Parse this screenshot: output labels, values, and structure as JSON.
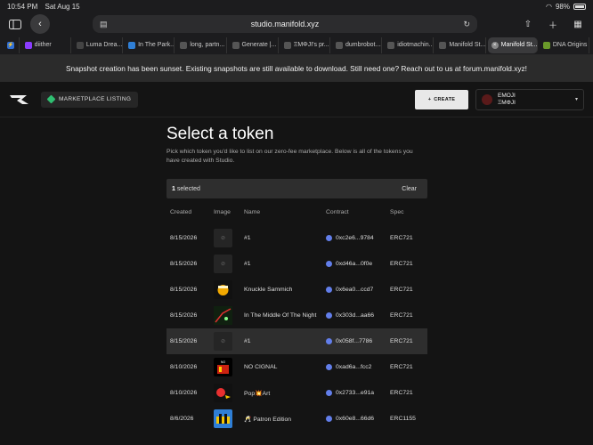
{
  "status": {
    "time": "10:54 PM",
    "date": "Sat Aug 15",
    "battery": "98%"
  },
  "browser": {
    "url": "studio.manifold.xyz",
    "tabs": [
      {
        "label": "diither",
        "color": "#8a3cff"
      },
      {
        "label": "Luma Drea...",
        "color": "#444"
      },
      {
        "label": "In The Park...",
        "color": "#2f7fd6"
      },
      {
        "label": "long, partn...",
        "color": "#555"
      },
      {
        "label": "Generate |...",
        "color": "#555"
      },
      {
        "label": "ΞMΦJI's pr...",
        "color": "#555"
      },
      {
        "label": "dumbrobot....",
        "color": "#555"
      },
      {
        "label": "idiotmachin...",
        "color": "#555"
      },
      {
        "label": "Manifold St...",
        "color": "#555"
      },
      {
        "label": "Manifold St...",
        "color": "#888",
        "active": true
      },
      {
        "label": "DNA Origins",
        "color": "#6a9a2a"
      }
    ]
  },
  "banner": {
    "text": "Snapshot creation has been sunset. Existing snapshots are still available to download. Still need one? Reach out to us at forum.manifold.xyz!"
  },
  "header": {
    "marketplace_label": "MARKETPLACE LISTING",
    "create_label": "CREATE",
    "account_line1": "EMOJI",
    "account_line2": "ΞMΦJI"
  },
  "main": {
    "title": "Select a token",
    "subtitle": "Pick which token you'd like to list on our zero-fee marketplace. Below is all of the tokens you have created with Studio.",
    "selected_count": "1",
    "selected_label": "selected",
    "clear_label": "Clear",
    "columns": [
      "Created",
      "Image",
      "Name",
      "Contract",
      "Spec"
    ],
    "rows": [
      {
        "created": "8/15/2026",
        "image": "empty",
        "name": "#1",
        "contract": "0xc2e6...9784",
        "spec": "ERC721"
      },
      {
        "created": "8/15/2026",
        "image": "empty",
        "name": "#1",
        "contract": "0xd46a...0f0e",
        "spec": "ERC721"
      },
      {
        "created": "8/15/2026",
        "image": "knuckle",
        "name": "Knuckle Sammich",
        "contract": "0x6ea0...ccd7",
        "spec": "ERC721"
      },
      {
        "created": "8/15/2026",
        "image": "middle",
        "name": "In The Middle Of The Night",
        "contract": "0x303d...aa66",
        "spec": "ERC721"
      },
      {
        "created": "8/15/2026",
        "image": "empty",
        "name": "#1",
        "contract": "0x058f...7786",
        "spec": "ERC721",
        "selected": true
      },
      {
        "created": "8/10/2026",
        "image": "cignal",
        "name": "NO CIGNAL",
        "contract": "0xad6a...fcc2",
        "spec": "ERC721"
      },
      {
        "created": "8/10/2026",
        "image": "pop",
        "name": "Pop💥Art",
        "contract": "0x2733...e91a",
        "spec": "ERC721"
      },
      {
        "created": "8/6/2026",
        "image": "patron",
        "name": "🥂 Patron Edition",
        "contract": "0x60e8...66d6",
        "spec": "ERC1155"
      }
    ]
  }
}
